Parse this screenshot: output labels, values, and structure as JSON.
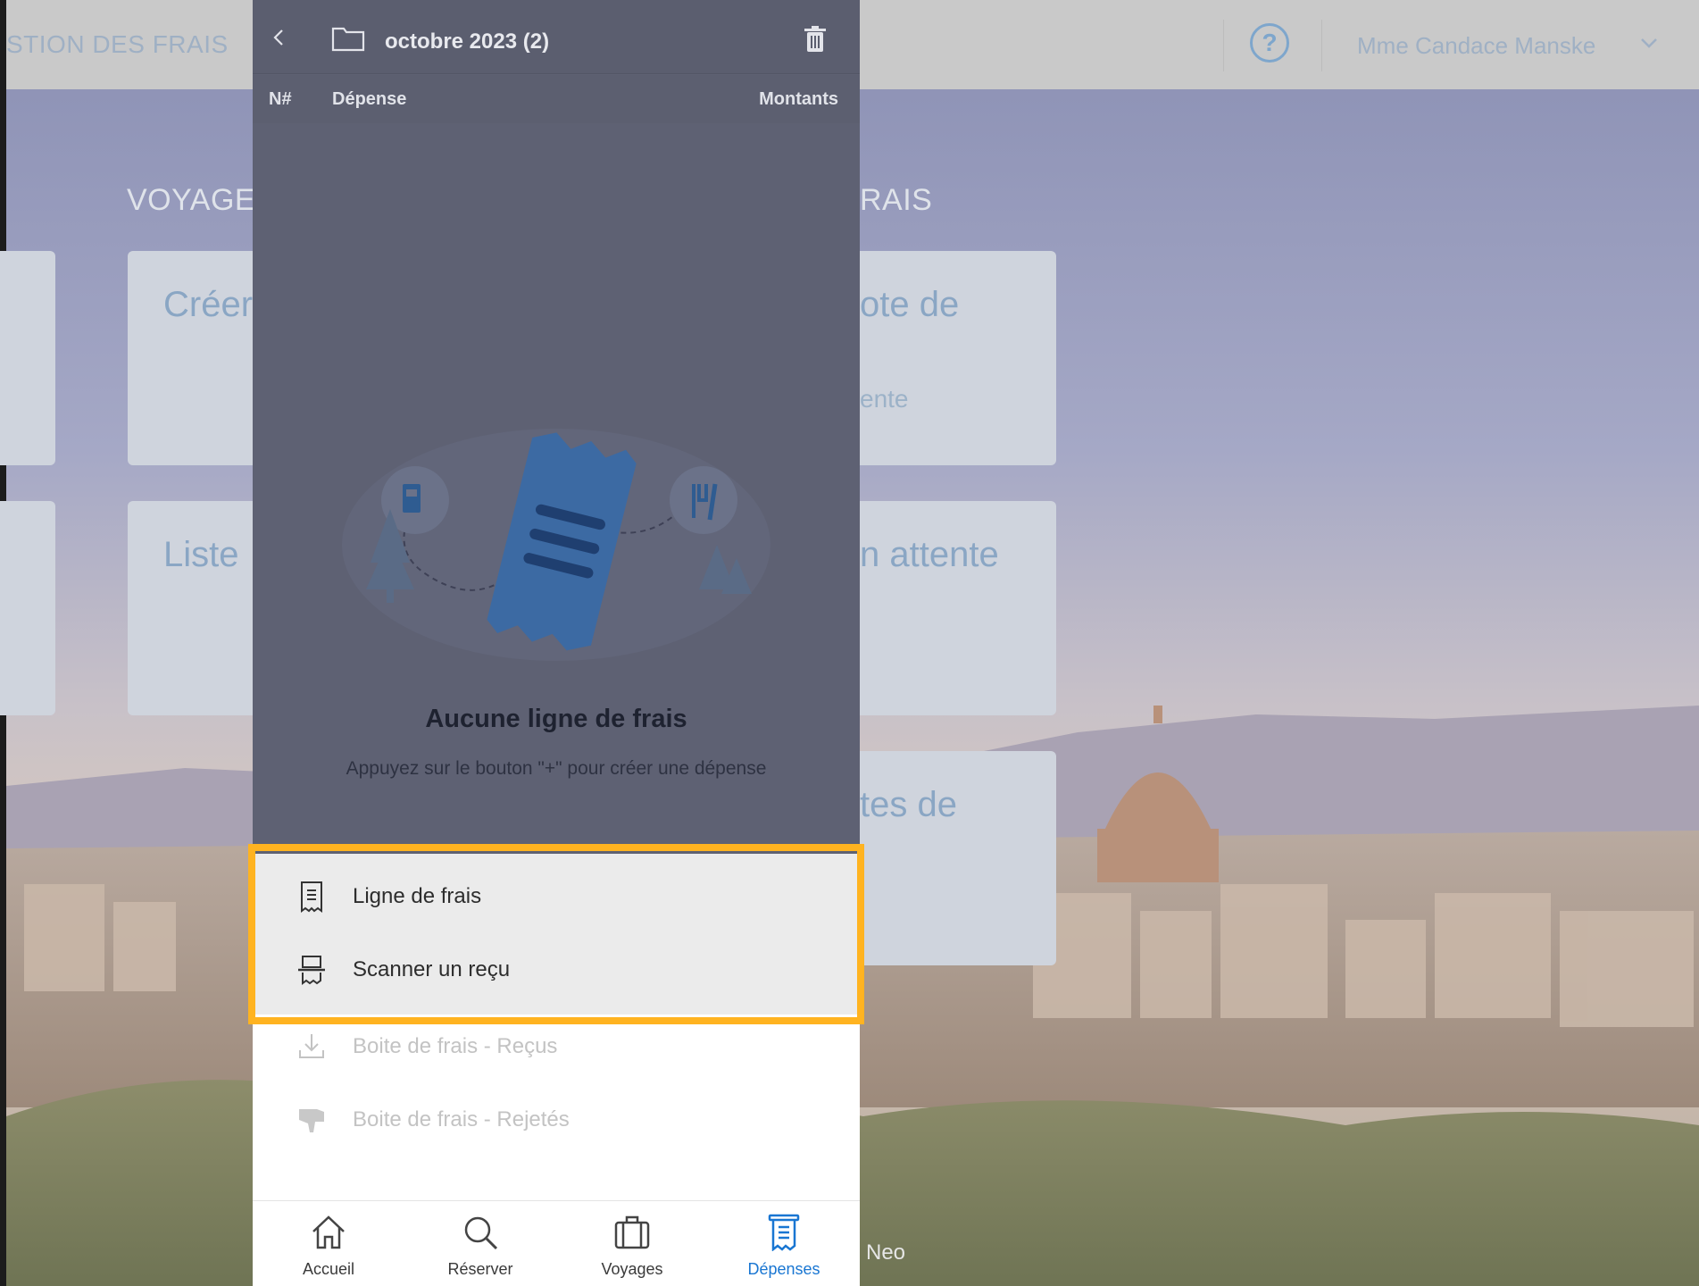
{
  "topbar": {
    "title": "STION DES FRAIS",
    "user_name": "Mme Candace Manske"
  },
  "dashboard": {
    "section_left": "VOYAGE",
    "section_right": "RAIS",
    "cards": [
      {
        "text": "Créer",
        "sub": ""
      },
      {
        "text": "ote de",
        "sub": "ente"
      },
      {
        "text": "Liste",
        "sub": ""
      },
      {
        "text": "n attente",
        "sub": ""
      },
      {
        "text": "tes de",
        "sub": ""
      }
    ],
    "footer_text": "Neo"
  },
  "panel": {
    "folder_title": "octobre 2023 (2)",
    "columns": {
      "num": "N#",
      "expense": "Dépense",
      "amount": "Montants"
    },
    "empty_title": "Aucune ligne de frais",
    "empty_subtitle": "Appuyez sur le bouton \"+\" pour créer une dépense",
    "menu": [
      {
        "label": "Ligne de frais",
        "icon": "receipt-icon",
        "enabled": true
      },
      {
        "label": "Scanner un reçu",
        "icon": "scanner-icon",
        "enabled": true
      },
      {
        "label": "Boite de frais - Reçus",
        "icon": "download-icon",
        "enabled": false
      },
      {
        "label": "Boite de frais - Rejetés",
        "icon": "thumbs-down-icon",
        "enabled": false
      }
    ],
    "nav": [
      {
        "label": "Accueil",
        "icon": "home-icon",
        "selected": false
      },
      {
        "label": "Réserver",
        "icon": "search-icon",
        "selected": false
      },
      {
        "label": "Voyages",
        "icon": "luggage-icon",
        "selected": false
      },
      {
        "label": "Dépenses",
        "icon": "expense-receipt-icon",
        "selected": true
      }
    ]
  },
  "colors": {
    "highlight": "#ffb320",
    "accent": "#1976d2",
    "overlay": "#5e6173"
  }
}
